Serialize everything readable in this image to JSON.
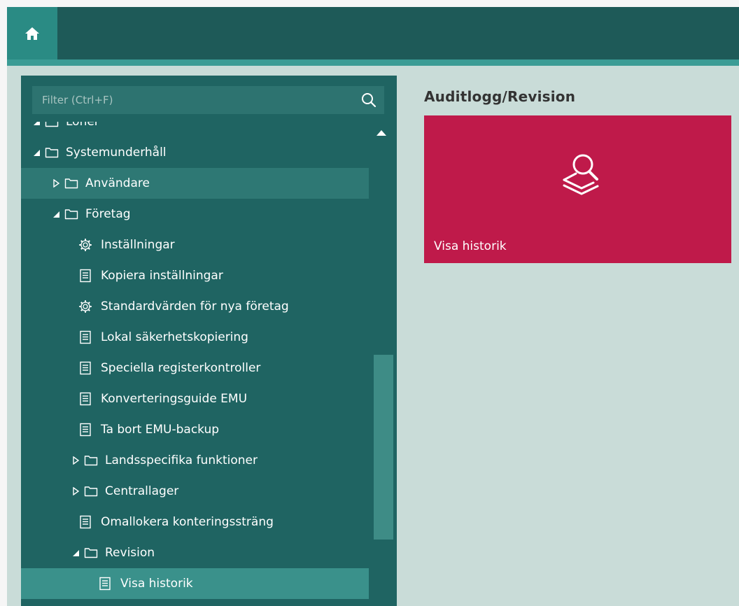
{
  "topbar": {
    "home_icon": "home-icon"
  },
  "sidebar": {
    "filter": {
      "placeholder": "Filter (Ctrl+F)",
      "value": ""
    },
    "tree": [
      {
        "label": "Löner",
        "level": 0,
        "type": "folder",
        "state": "expanded-partial"
      },
      {
        "label": "Systemunderhåll",
        "level": 0,
        "type": "folder",
        "state": "expanded"
      },
      {
        "label": "Användare",
        "level": 1,
        "type": "folder",
        "state": "collapsed"
      },
      {
        "label": "Företag",
        "level": 1,
        "type": "folder",
        "state": "expanded"
      },
      {
        "label": "Inställningar",
        "level": 2,
        "type": "settings"
      },
      {
        "label": "Kopiera inställningar",
        "level": 2,
        "type": "document"
      },
      {
        "label": "Standardvärden för nya företag",
        "level": 2,
        "type": "settings"
      },
      {
        "label": "Lokal säkerhetskopiering",
        "level": 2,
        "type": "document"
      },
      {
        "label": "Speciella registerkontroller",
        "level": 2,
        "type": "document"
      },
      {
        "label": "Konverteringsguide EMU",
        "level": 2,
        "type": "document"
      },
      {
        "label": "Ta bort EMU-backup",
        "level": 2,
        "type": "document"
      },
      {
        "label": "Landsspecifika funktioner",
        "level": 2,
        "type": "folder",
        "state": "collapsed"
      },
      {
        "label": "Centrallager",
        "level": 2,
        "type": "folder",
        "state": "collapsed"
      },
      {
        "label": "Omallokera konteringssträng",
        "level": 2,
        "type": "document"
      },
      {
        "label": "Revision",
        "level": 2,
        "type": "folder",
        "state": "expanded"
      },
      {
        "label": "Visa historik",
        "level": 3,
        "type": "document"
      }
    ]
  },
  "panel": {
    "title": "Auditlogg/Revision",
    "tile": {
      "label": "Visa historik",
      "icon": "search-history-icon",
      "color": "#bf1a4a"
    }
  },
  "colors": {
    "topbar": "#1e5a58",
    "accent": "#2a8b84",
    "sidebar": "#1f6462",
    "content_bg": "#c9dcd8"
  }
}
